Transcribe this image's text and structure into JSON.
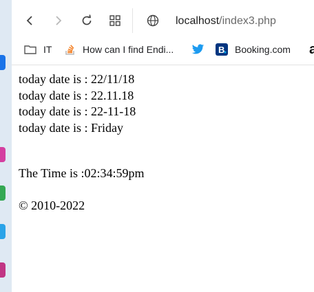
{
  "browser": {
    "url_host": "localhost",
    "url_path": "/index3.php",
    "bookmarks": [
      {
        "label": "IT",
        "icon": "folder-icon"
      },
      {
        "label": "How can I find Endi...",
        "icon": "stackoverflow-icon"
      },
      {
        "label": "",
        "icon": "twitter-icon"
      },
      {
        "label": "Booking.com",
        "icon": "booking-icon"
      },
      {
        "label": "a",
        "icon": "amazon-icon"
      }
    ]
  },
  "page": {
    "lines": [
      "today date is : 22/11/18",
      "today date is : 22.11.18",
      "today date is : 22-11-18",
      "today date is : Friday"
    ],
    "time_text": "The Time is :02:34:59pm",
    "copyright": "© 2010-2022"
  },
  "colors": {
    "twitter": "#1d9bf0",
    "booking": "#003580",
    "stackoverflow": "#f48024"
  }
}
